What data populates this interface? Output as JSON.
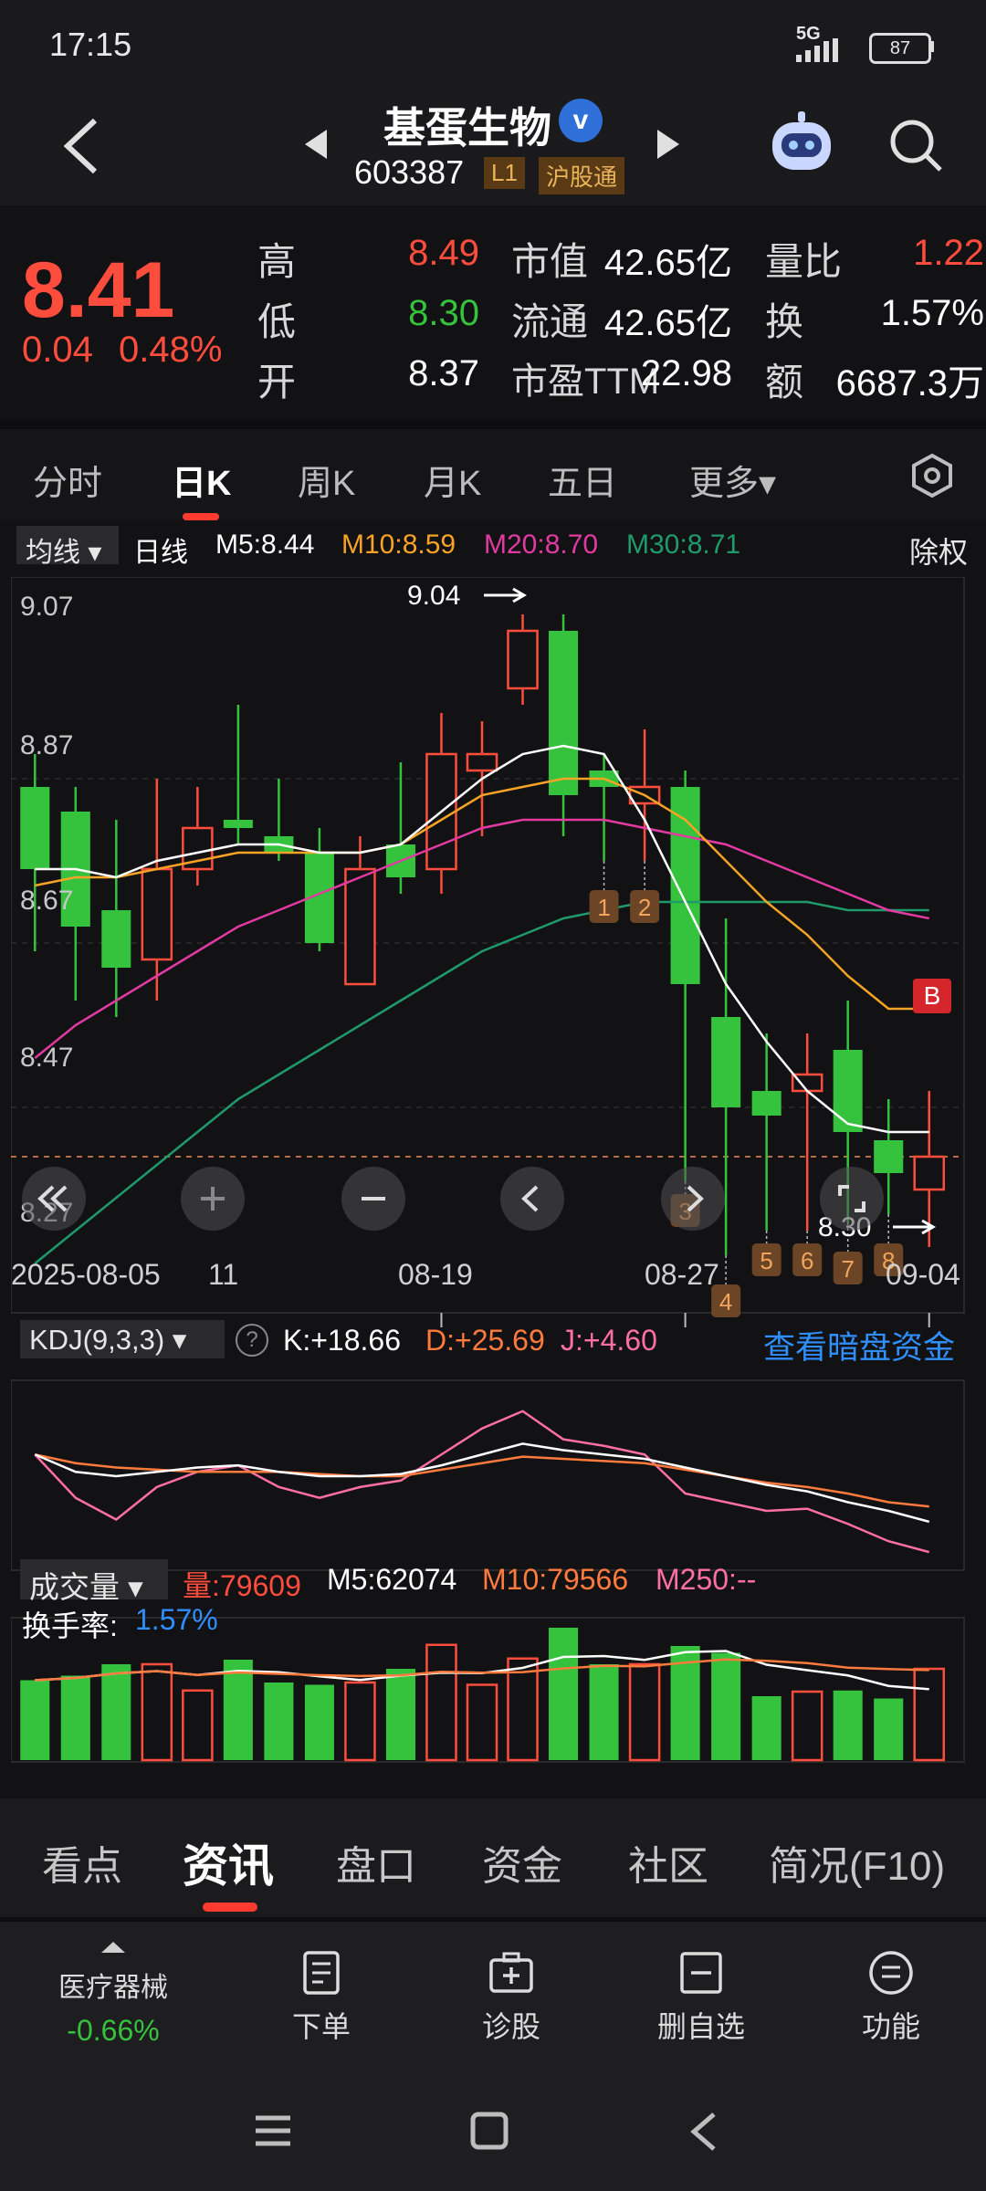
{
  "status": {
    "time": "17:15",
    "network": "5G",
    "battery": "87"
  },
  "header": {
    "name": "基蛋生物",
    "code": "603387",
    "level": "L1",
    "market": "沪股通",
    "verified_icon": "v-badge-icon"
  },
  "quote": {
    "price": "8.41",
    "change": "0.04",
    "change_pct": "0.48%",
    "high_label": "高",
    "high": "8.49",
    "low_label": "低",
    "low": "8.30",
    "open_label": "开",
    "open": "8.37",
    "mcap_label": "市值",
    "mcap": "42.65亿",
    "float_label": "流通",
    "float": "42.65亿",
    "pe_label": "市盈TTM",
    "pe": "22.98",
    "vr_label": "量比",
    "vr": "1.22",
    "turnover_label": "换",
    "turnover": "1.57%",
    "amount_label": "额",
    "amount": "6687.3万"
  },
  "period_tabs": [
    "分时",
    "日K",
    "周K",
    "月K",
    "五日",
    "更多▾"
  ],
  "ma_bar": {
    "select": "均线 ▾",
    "type": "日线",
    "m5": "M5:8.44",
    "m10": "M10:8.59",
    "m20": "M20:8.70",
    "m30": "M30:8.71",
    "adjust": "除权"
  },
  "price_axis": [
    "9.07",
    "8.87",
    "8.67",
    "8.47",
    "8.27"
  ],
  "annotations": {
    "high_mark": "9.04",
    "low_mark": "8.30",
    "signal": "B"
  },
  "date_axis": [
    "2025-08-05",
    "11",
    "08-19",
    "08-27",
    "09-04"
  ],
  "kdj": {
    "select": "KDJ(9,3,3) ▾",
    "k": "K:+18.66",
    "d": "D:+25.69",
    "j": "J:+4.60",
    "link": "查看暗盘资金"
  },
  "volume": {
    "select": "成交量 ▾",
    "vol": "量:79609",
    "m5": "M5:62074",
    "m10": "M10:79566",
    "m250": "M250:--",
    "turnover_label": "换手率:",
    "turnover": "1.57%"
  },
  "chart_data": {
    "type": "candlestick",
    "ylim": [
      8.22,
      9.1
    ],
    "candles": [
      {
        "o": 8.76,
        "c": 8.86,
        "h": 8.9,
        "l": 8.66,
        "color": "green"
      },
      {
        "o": 8.69,
        "c": 8.83,
        "h": 8.86,
        "l": 8.6,
        "color": "green"
      },
      {
        "o": 8.64,
        "c": 8.71,
        "h": 8.82,
        "l": 8.58,
        "color": "green"
      },
      {
        "o": 8.65,
        "c": 8.76,
        "h": 8.87,
        "l": 8.6,
        "color": "red"
      },
      {
        "o": 8.76,
        "c": 8.81,
        "h": 8.86,
        "l": 8.74,
        "color": "red"
      },
      {
        "o": 8.81,
        "c": 8.82,
        "h": 8.96,
        "l": 8.79,
        "color": "green"
      },
      {
        "o": 8.78,
        "c": 8.8,
        "h": 8.87,
        "l": 8.77,
        "color": "green"
      },
      {
        "o": 8.67,
        "c": 8.78,
        "h": 8.81,
        "l": 8.66,
        "color": "green"
      },
      {
        "o": 8.62,
        "c": 8.76,
        "h": 8.8,
        "l": 8.62,
        "color": "red"
      },
      {
        "o": 8.75,
        "c": 8.79,
        "h": 8.89,
        "l": 8.73,
        "color": "green"
      },
      {
        "o": 8.76,
        "c": 8.9,
        "h": 8.95,
        "l": 8.73,
        "color": "red"
      },
      {
        "o": 8.88,
        "c": 8.9,
        "h": 8.94,
        "l": 8.8,
        "color": "red"
      },
      {
        "o": 8.98,
        "c": 9.05,
        "h": 9.07,
        "l": 8.96,
        "color": "red"
      },
      {
        "o": 9.05,
        "c": 8.85,
        "h": 9.07,
        "l": 8.8,
        "color": "green"
      },
      {
        "o": 8.86,
        "c": 8.88,
        "h": 8.9,
        "l": 8.77,
        "color": "green"
      },
      {
        "o": 8.84,
        "c": 8.86,
        "h": 8.93,
        "l": 8.77,
        "color": "red"
      },
      {
        "o": 8.86,
        "c": 8.62,
        "h": 8.88,
        "l": 8.38,
        "color": "green"
      },
      {
        "o": 8.58,
        "c": 8.47,
        "h": 8.7,
        "l": 8.29,
        "color": "green"
      },
      {
        "o": 8.49,
        "c": 8.46,
        "h": 8.56,
        "l": 8.32,
        "color": "green"
      },
      {
        "o": 8.49,
        "c": 8.51,
        "h": 8.56,
        "l": 8.32,
        "color": "red"
      },
      {
        "o": 8.54,
        "c": 8.44,
        "h": 8.6,
        "l": 8.33,
        "color": "green"
      },
      {
        "o": 8.43,
        "c": 8.39,
        "h": 8.48,
        "l": 8.34,
        "color": "green"
      },
      {
        "o": 8.37,
        "c": 8.41,
        "h": 8.49,
        "l": 8.3,
        "color": "red"
      }
    ],
    "volumes": [
      {
        "v": 70,
        "color": "green"
      },
      {
        "v": 74,
        "color": "green"
      },
      {
        "v": 84,
        "color": "green"
      },
      {
        "v": 84,
        "color": "red"
      },
      {
        "v": 61,
        "color": "red"
      },
      {
        "v": 88,
        "color": "green"
      },
      {
        "v": 68,
        "color": "green"
      },
      {
        "v": 66,
        "color": "green"
      },
      {
        "v": 68,
        "color": "red"
      },
      {
        "v": 80,
        "color": "green"
      },
      {
        "v": 101,
        "color": "red"
      },
      {
        "v": 66,
        "color": "red"
      },
      {
        "v": 89,
        "color": "red"
      },
      {
        "v": 116,
        "color": "green"
      },
      {
        "v": 84,
        "color": "green"
      },
      {
        "v": 84,
        "color": "red"
      },
      {
        "v": 100,
        "color": "green"
      },
      {
        "v": 94,
        "color": "green"
      },
      {
        "v": 56,
        "color": "green"
      },
      {
        "v": 60,
        "color": "red"
      },
      {
        "v": 61,
        "color": "green"
      },
      {
        "v": 54,
        "color": "green"
      },
      {
        "v": 80,
        "color": "red"
      }
    ],
    "ma5": [
      8.76,
      8.76,
      8.75,
      8.77,
      8.78,
      8.79,
      8.79,
      8.78,
      8.78,
      8.79,
      8.83,
      8.87,
      8.9,
      8.91,
      8.9,
      8.82,
      8.72,
      8.62,
      8.55,
      8.49,
      8.45,
      8.44,
      8.44
    ],
    "ma10": [
      8.74,
      8.75,
      8.75,
      8.76,
      8.77,
      8.78,
      8.78,
      8.78,
      8.78,
      8.79,
      8.82,
      8.85,
      8.86,
      8.87,
      8.87,
      8.85,
      8.82,
      8.77,
      8.72,
      8.68,
      8.63,
      8.59,
      8.59
    ],
    "ma20": [
      8.53,
      8.57,
      8.6,
      8.63,
      8.66,
      8.69,
      8.71,
      8.73,
      8.75,
      8.77,
      8.79,
      8.81,
      8.82,
      8.82,
      8.82,
      8.81,
      8.8,
      8.79,
      8.77,
      8.75,
      8.73,
      8.71,
      8.7
    ],
    "ma30": [
      8.28,
      8.32,
      8.36,
      8.4,
      8.44,
      8.48,
      8.51,
      8.54,
      8.57,
      8.6,
      8.63,
      8.66,
      8.68,
      8.7,
      8.71,
      8.72,
      8.72,
      8.72,
      8.72,
      8.72,
      8.71,
      8.71,
      8.71
    ],
    "markers": [
      {
        "i": 14,
        "label": "1"
      },
      {
        "i": 15,
        "label": "2"
      },
      {
        "i": 16,
        "label": "3"
      },
      {
        "i": 17,
        "label": "4"
      },
      {
        "i": 18,
        "label": "5"
      },
      {
        "i": 19,
        "label": "6"
      },
      {
        "i": 20,
        "label": "7"
      },
      {
        "i": 21,
        "label": "8"
      }
    ],
    "kdj_k": [
      50,
      42,
      40,
      42,
      44,
      45,
      42,
      40,
      40,
      41,
      45,
      50,
      55,
      52,
      50,
      48,
      44,
      40,
      36,
      33,
      28,
      24,
      19
    ],
    "kdj_d": [
      50,
      46,
      44,
      43,
      42,
      42,
      42,
      41,
      40,
      40,
      43,
      46,
      49,
      48,
      47,
      46,
      43,
      40,
      37,
      35,
      32,
      28,
      26
    ],
    "kdj_j": [
      50,
      30,
      20,
      35,
      42,
      45,
      35,
      30,
      35,
      38,
      50,
      62,
      70,
      57,
      54,
      50,
      32,
      28,
      24,
      25,
      18,
      10,
      5
    ]
  },
  "bottom_tabs": [
    "看点",
    "资讯",
    "盘口",
    "资金",
    "社区",
    "简况(F10)"
  ],
  "actions": {
    "sector_name": "医疗器械",
    "sector_change": "-0.66%",
    "order": "下单",
    "diagnose": "诊股",
    "remove": "删自选",
    "function": "功能"
  },
  "colors": {
    "up": "#ff4d3d",
    "down": "#35c23c",
    "ma5": "#ffffff",
    "ma10": "#f7a325",
    "ma20": "#e23aa2",
    "ma30": "#1f9a6a",
    "accent": "#2f8fff"
  }
}
